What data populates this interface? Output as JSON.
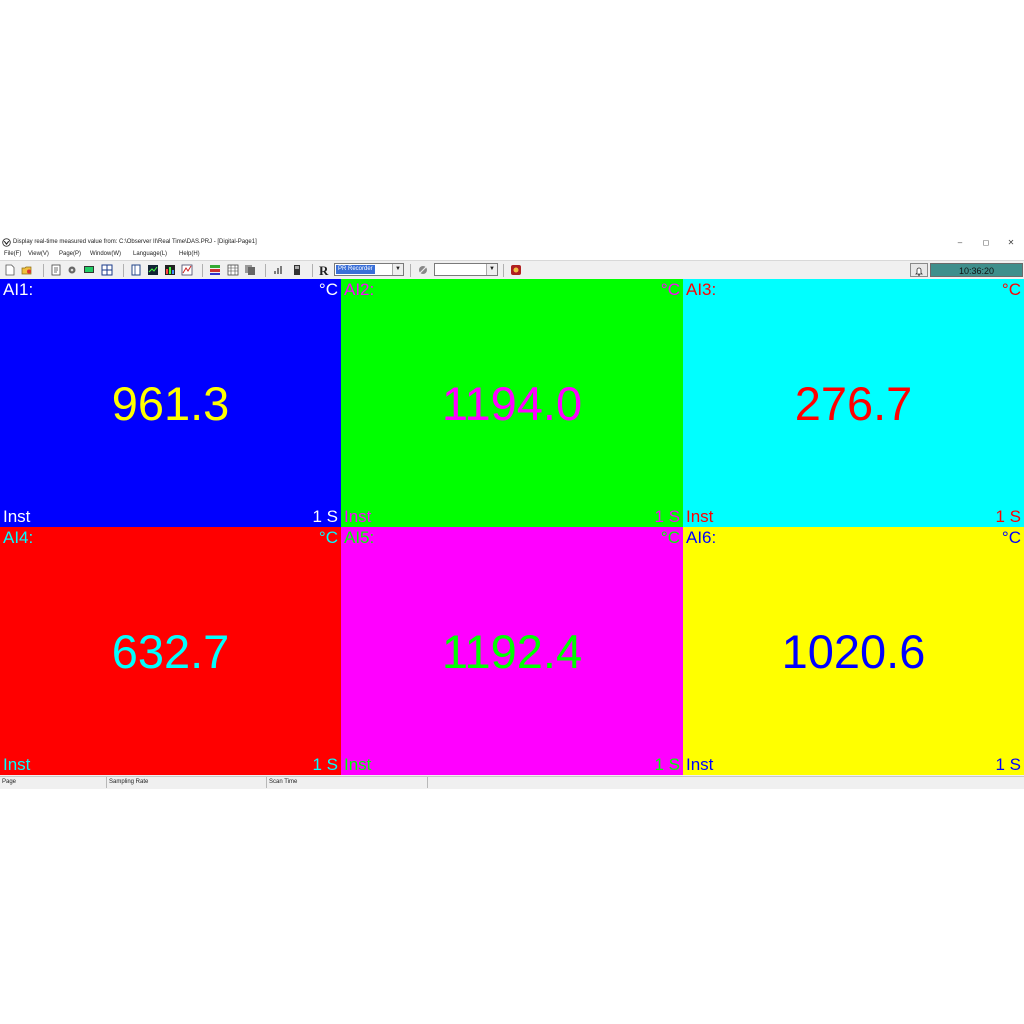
{
  "window": {
    "title": "Display real-time measured value from: C:\\Observer II\\Real Time\\DAS.PRJ - [Digital-Page1]",
    "controls": [
      "–",
      "◻",
      "✕"
    ]
  },
  "menu": [
    "File(F)",
    "View(V)",
    "Page(P)",
    "Window(W)",
    "Language(L)",
    "Help(H)"
  ],
  "toolbar": {
    "icons": [
      "new-icon",
      "open-icon",
      "print-icon",
      "settings-icon",
      "monitor-icon",
      "layout-icon",
      "page-icon",
      "trend-icon",
      "bar-icon",
      "chart-icon",
      "digital-icon",
      "table-icon",
      "copy-icon",
      "signal-icon",
      "device-icon",
      "recorder-icon",
      "tool-icon",
      "export-icon"
    ],
    "r_label": "R",
    "recorder_select": "PR Recorder",
    "second_select": "",
    "clock": "10:36:20"
  },
  "panels": [
    {
      "name": "AI1:",
      "unit": "°C",
      "value": "961.3",
      "mode": "Inst",
      "rate": "1 S",
      "bg": "#0000ff",
      "fg": "#ffff00",
      "label_color": "#ffffff"
    },
    {
      "name": "AI2:",
      "unit": "°C",
      "value": "1194.0",
      "mode": "Inst",
      "rate": "1 S",
      "bg": "#00ff00",
      "fg": "#ff00ff",
      "label_color": "#ff00ff"
    },
    {
      "name": "AI3:",
      "unit": "°C",
      "value": "276.7",
      "mode": "Inst",
      "rate": "1 S",
      "bg": "#00ffff",
      "fg": "#ff0000",
      "label_color": "#ff0000"
    },
    {
      "name": "AI4:",
      "unit": "°C",
      "value": "632.7",
      "mode": "Inst",
      "rate": "1 S",
      "bg": "#ff0000",
      "fg": "#00ffff",
      "label_color": "#00ffff"
    },
    {
      "name": "AI5:",
      "unit": "°C",
      "value": "1192.4",
      "mode": "Inst",
      "rate": "1 S",
      "bg": "#ff00ff",
      "fg": "#00ff00",
      "label_color": "#00ff00"
    },
    {
      "name": "AI6:",
      "unit": "°C",
      "value": "1020.6",
      "mode": "Inst",
      "rate": "1 S",
      "bg": "#ffff00",
      "fg": "#0000ff",
      "label_color": "#0000ff"
    }
  ],
  "status": [
    "Page",
    "Sampling Rate",
    "Scan Time",
    ""
  ]
}
